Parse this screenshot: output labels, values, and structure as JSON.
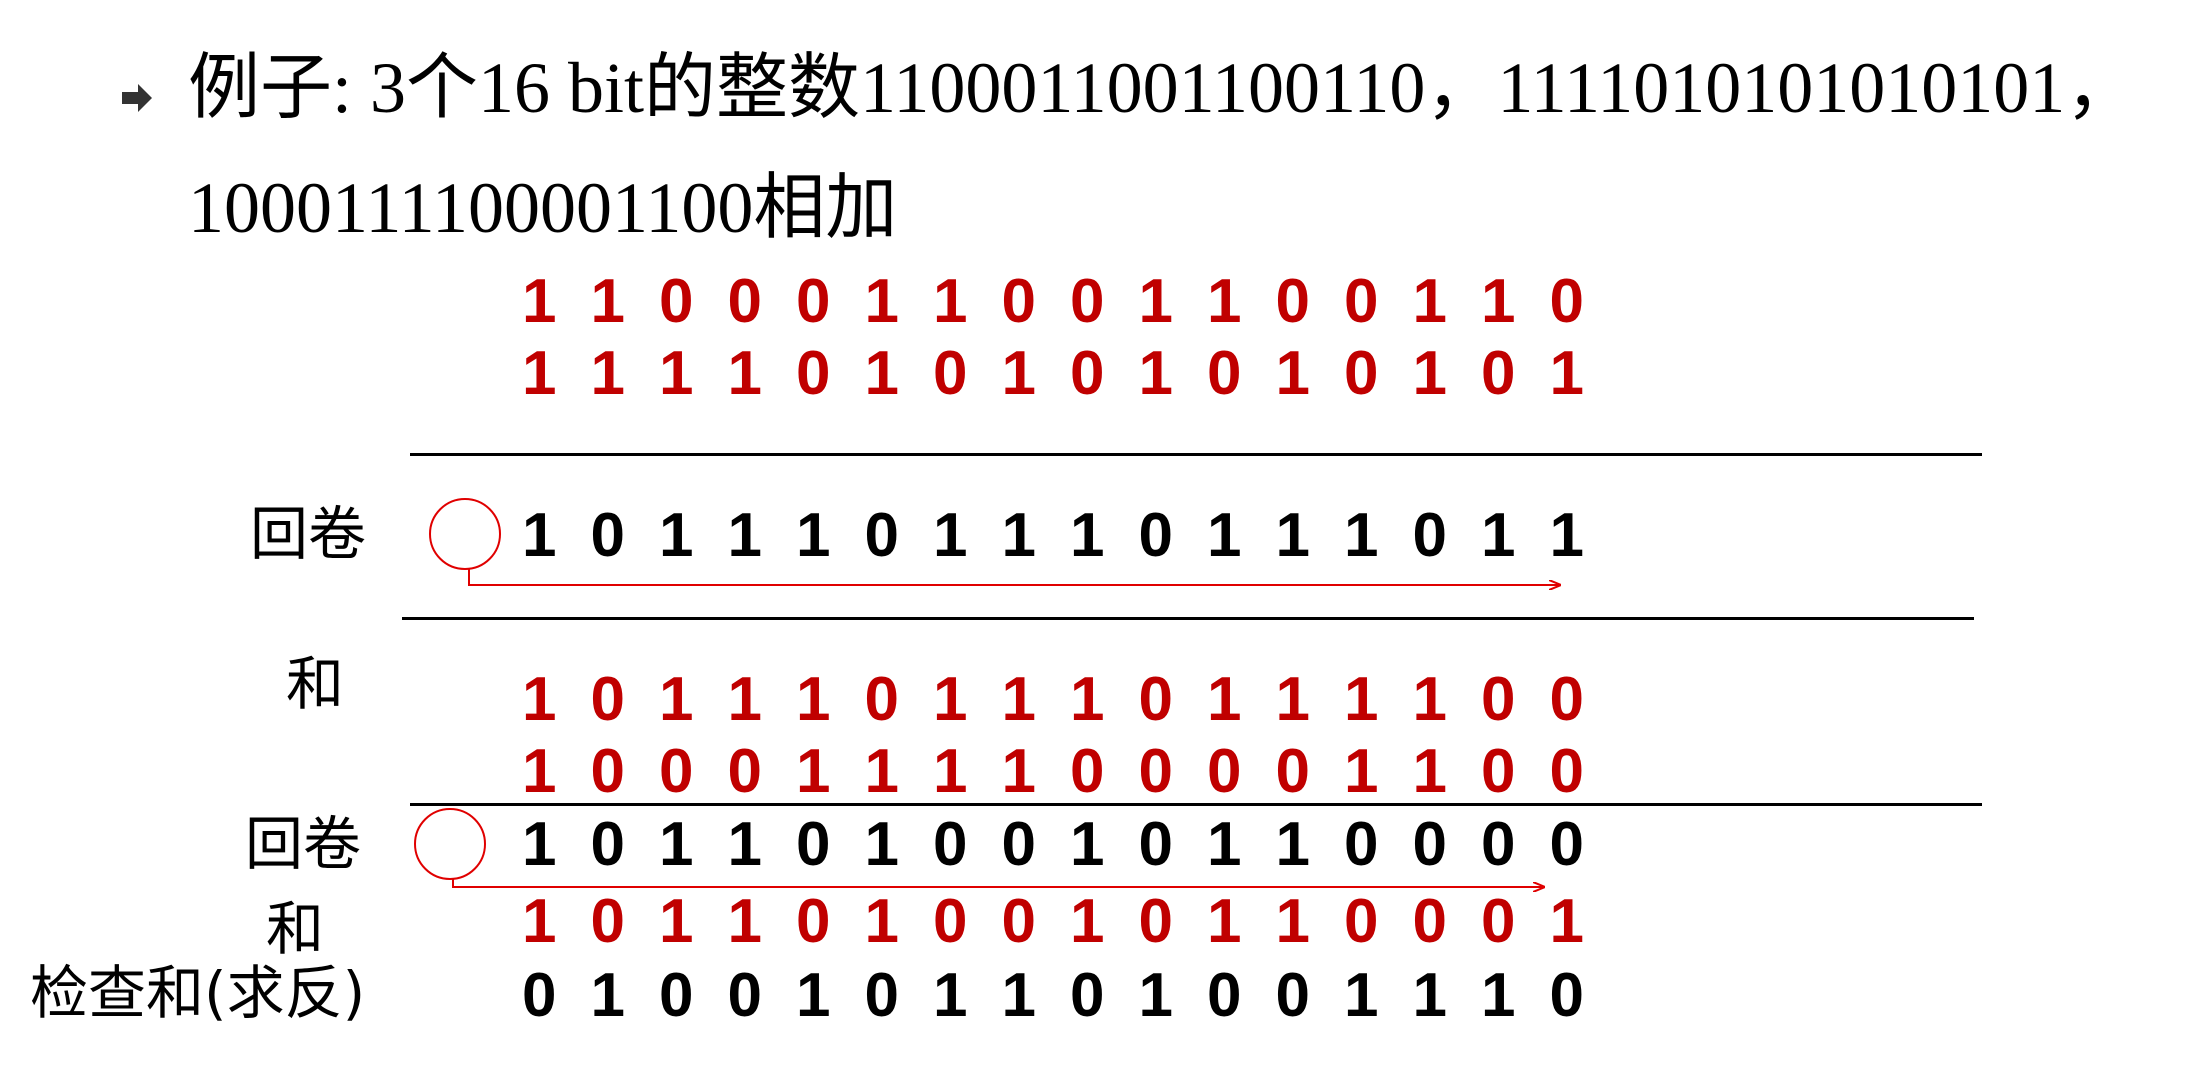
{
  "heading": {
    "line1": "例子: 3个16 bit的整数1100011001100110，1111010101010101，",
    "line2": "1000111100001100相加"
  },
  "rows": {
    "row1": "1100011001100110",
    "row2": "1111010101010101",
    "wrap1": "1011101110111011",
    "sum1": "1011101110111100",
    "row3": "1000111100001100",
    "wrap2": "1011010010110000",
    "sum2": "1011010010110001",
    "checksum": "0100101101001110"
  },
  "labels": {
    "wrap1": "回卷",
    "sum1": "和",
    "wrap2": "回卷",
    "sum2": "和",
    "checksum": "检查和(求反)"
  },
  "colors": {
    "red": "#c00000",
    "black": "#000000",
    "arrow": "#e00000"
  },
  "icons": {
    "bullet": "arrow-bullet-icon"
  }
}
